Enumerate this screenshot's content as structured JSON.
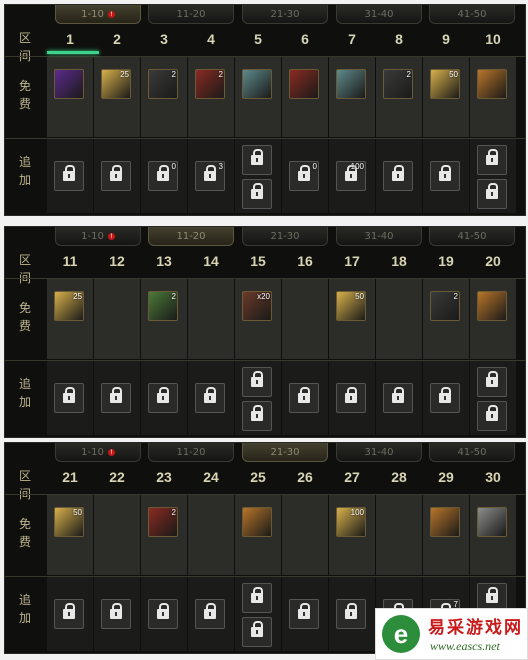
{
  "labels": {
    "interval": [
      "区",
      "间"
    ],
    "free": [
      "免",
      "费"
    ],
    "extra": [
      "追",
      "加"
    ]
  },
  "tabs": [
    "1-10",
    "11-20",
    "21-30",
    "31-40",
    "41-50"
  ],
  "tab_alert_mark": "!",
  "panels": [
    {
      "active_tab": 0,
      "days": [
        {
          "n": "1",
          "free": "purple",
          "cnt": "",
          "extras": [
            {
              "cnt": ""
            }
          ],
          "current": true
        },
        {
          "n": "2",
          "free": "gold",
          "cnt": "25",
          "extras": [
            {
              "cnt": ""
            }
          ]
        },
        {
          "n": "3",
          "free": "dark",
          "cnt": "2",
          "extras": [
            {
              "cnt": "0"
            }
          ]
        },
        {
          "n": "4",
          "free": "red",
          "cnt": "2",
          "extras": [
            {
              "cnt": "3"
            }
          ]
        },
        {
          "n": "5",
          "free": "teal",
          "cnt": "",
          "extras": [
            {
              "cnt": ""
            },
            {
              "cnt": ""
            }
          ]
        },
        {
          "n": "6",
          "free": "red",
          "cnt": "",
          "extras": [
            {
              "cnt": "0"
            }
          ]
        },
        {
          "n": "7",
          "free": "teal",
          "cnt": "",
          "extras": [
            {
              "cnt": "100"
            }
          ]
        },
        {
          "n": "8",
          "free": "dark",
          "cnt": "2",
          "extras": [
            {
              "cnt": ""
            }
          ]
        },
        {
          "n": "9",
          "free": "gold",
          "cnt": "50",
          "extras": [
            {
              "cnt": ""
            }
          ]
        },
        {
          "n": "10",
          "free": "orange",
          "cnt": "",
          "extras": [
            {
              "cnt": ""
            },
            {
              "cnt": ""
            }
          ]
        }
      ]
    },
    {
      "active_tab": 1,
      "days": [
        {
          "n": "11",
          "free": "gold",
          "cnt": "25",
          "extras": [
            {
              "cnt": ""
            }
          ]
        },
        {
          "n": "12",
          "free": "",
          "cnt": "",
          "extras": [
            {
              "cnt": ""
            }
          ]
        },
        {
          "n": "13",
          "free": "green",
          "cnt": "2",
          "extras": [
            {
              "cnt": ""
            }
          ]
        },
        {
          "n": "14",
          "free": "",
          "cnt": "",
          "extras": [
            {
              "cnt": ""
            }
          ]
        },
        {
          "n": "15",
          "free": "star",
          "cnt": "x20",
          "extras": [
            {
              "cnt": ""
            },
            {
              "cnt": ""
            }
          ]
        },
        {
          "n": "16",
          "free": "",
          "cnt": "",
          "extras": [
            {
              "cnt": ""
            }
          ]
        },
        {
          "n": "17",
          "free": "gold",
          "cnt": "50",
          "extras": [
            {
              "cnt": ""
            }
          ]
        },
        {
          "n": "18",
          "free": "",
          "cnt": "",
          "extras": [
            {
              "cnt": ""
            }
          ]
        },
        {
          "n": "19",
          "free": "dark",
          "cnt": "2",
          "extras": [
            {
              "cnt": ""
            }
          ]
        },
        {
          "n": "20",
          "free": "orange",
          "cnt": "",
          "extras": [
            {
              "cnt": ""
            },
            {
              "cnt": ""
            }
          ]
        }
      ]
    },
    {
      "active_tab": 2,
      "days": [
        {
          "n": "21",
          "free": "gold",
          "cnt": "50",
          "extras": [
            {
              "cnt": ""
            }
          ]
        },
        {
          "n": "22",
          "free": "",
          "cnt": "",
          "extras": [
            {
              "cnt": ""
            }
          ]
        },
        {
          "n": "23",
          "free": "red",
          "cnt": "2",
          "extras": [
            {
              "cnt": ""
            }
          ]
        },
        {
          "n": "24",
          "free": "",
          "cnt": "",
          "extras": [
            {
              "cnt": ""
            }
          ]
        },
        {
          "n": "25",
          "free": "orange",
          "cnt": "",
          "extras": [
            {
              "cnt": ""
            },
            {
              "cnt": ""
            }
          ]
        },
        {
          "n": "26",
          "free": "",
          "cnt": "",
          "extras": [
            {
              "cnt": ""
            }
          ]
        },
        {
          "n": "27",
          "free": "gold",
          "cnt": "100",
          "extras": [
            {
              "cnt": ""
            }
          ]
        },
        {
          "n": "28",
          "free": "",
          "cnt": "",
          "extras": [
            {
              "cnt": ""
            }
          ]
        },
        {
          "n": "29",
          "free": "orange",
          "cnt": "",
          "extras": [
            {
              "cnt": "7"
            }
          ]
        },
        {
          "n": "30",
          "free": "silver",
          "cnt": "",
          "extras": [
            {
              "cnt": ""
            },
            {
              "cnt": ""
            }
          ]
        }
      ]
    }
  ],
  "item_colors": {
    "purple": "#5b2a8e",
    "gold": "#d6b04a",
    "dark": "#3a3a3a",
    "red": "#8a2a22",
    "teal": "#5e8a8c",
    "orange": "#b8752a",
    "green": "#4b7a3a",
    "star": "#6a3a2a",
    "silver": "#8d8d8d"
  },
  "watermark": {
    "logo": "e",
    "title": "易采游戏网",
    "url": "www.eascs.net"
  }
}
